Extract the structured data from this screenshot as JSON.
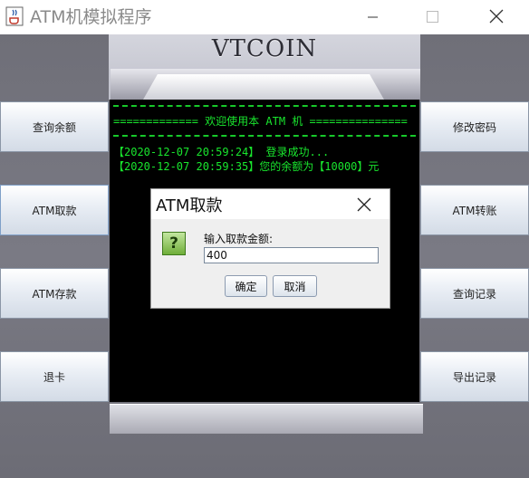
{
  "window": {
    "title": "ATM机模拟程序"
  },
  "brand": "VTCOIN",
  "screen": {
    "banner": "============= 欢迎使用本 ATM 机 ===============",
    "log": [
      "【2020-12-07 20:59:24】 登录成功...",
      "【2020-12-07 20:59:35】您的余额为【10000】元"
    ]
  },
  "left_buttons": [
    "查询余额",
    "ATM取款",
    "ATM存款",
    "退卡"
  ],
  "right_buttons": [
    "修改密码",
    "ATM转账",
    "查询记录",
    "导出记录"
  ],
  "dialog": {
    "title": "ATM取款",
    "icon_glyph": "?",
    "prompt": "输入取款金额:",
    "input_value": "400",
    "ok_label": "确定",
    "cancel_label": "取消"
  },
  "icons": {
    "app": "java-cup-icon",
    "minimize": "minimize-icon",
    "maximize": "maximize-icon",
    "close": "close-icon",
    "question": "question-icon"
  }
}
